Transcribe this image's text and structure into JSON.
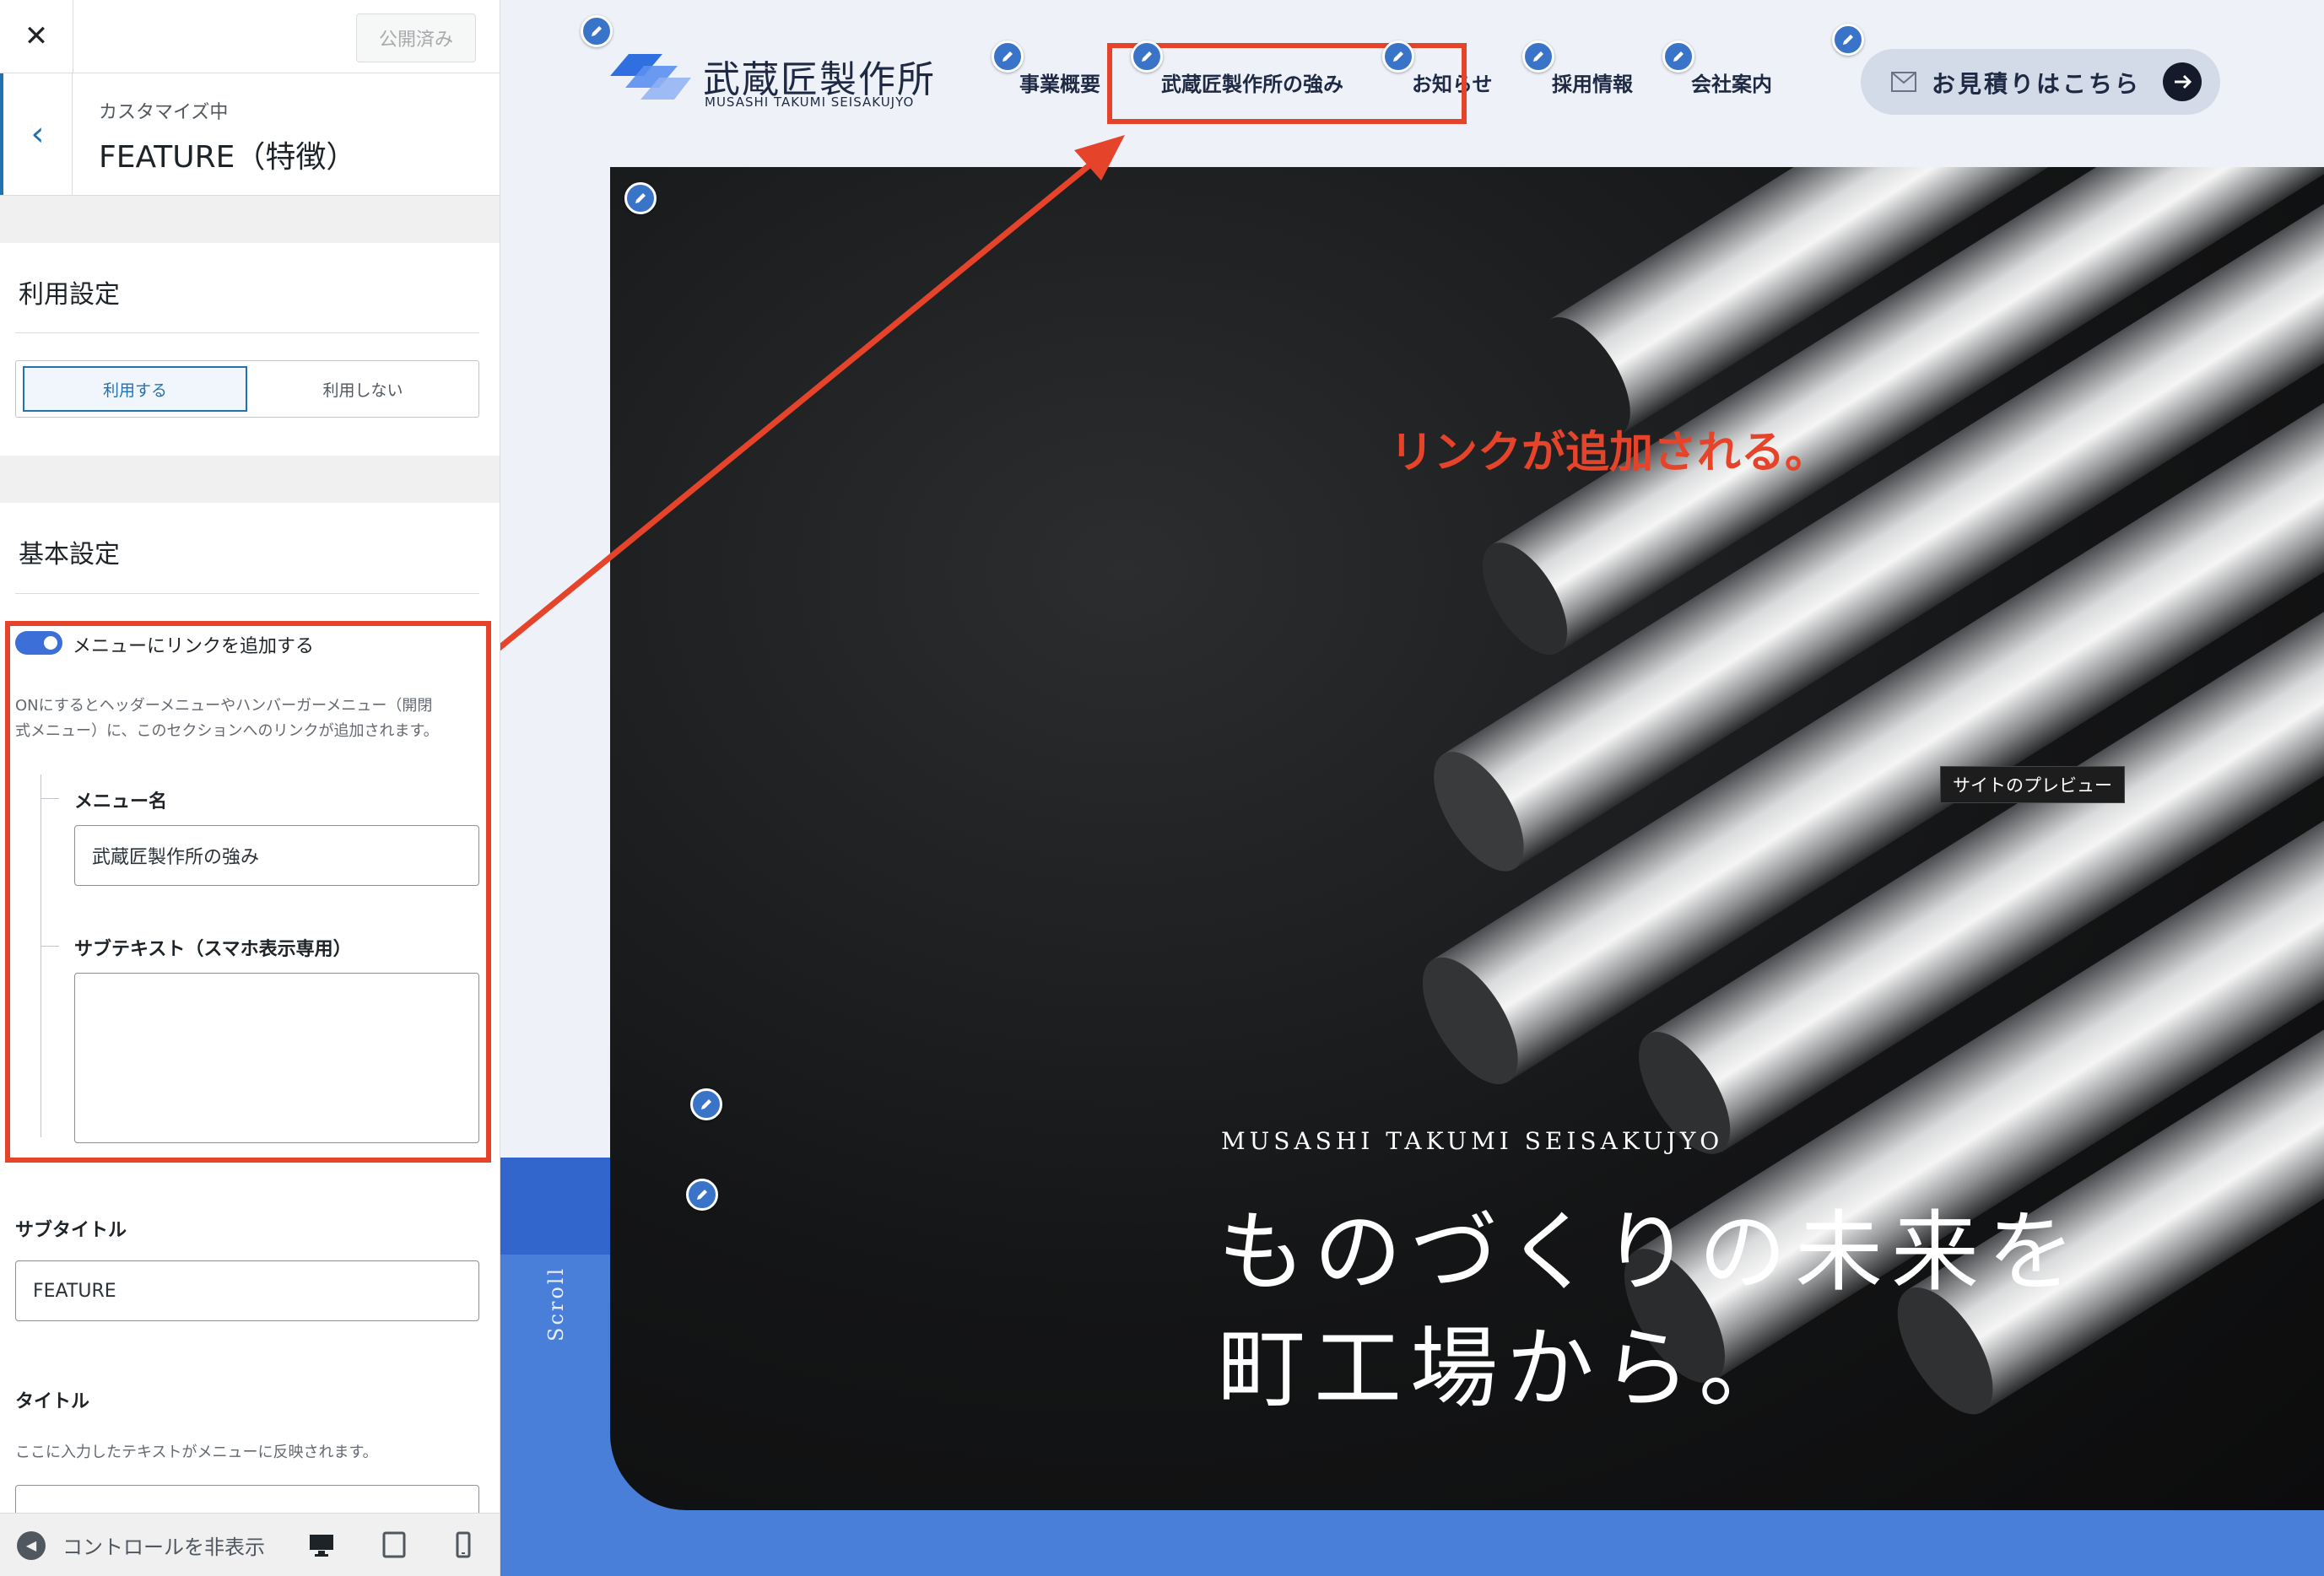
{
  "sidebar": {
    "publish_label": "公開済み",
    "crumb": "カスタマイズ中",
    "title": "FEATURE（特徴）",
    "usage": {
      "heading": "利用設定",
      "on_label": "利用する",
      "off_label": "利用しない",
      "selected": "利用する"
    },
    "basic": {
      "heading": "基本設定",
      "toggle_label": "メニューにリンクを追加する",
      "toggle_on": true,
      "desc_line1": "ONにするとヘッダーメニューやハンバーガーメニュー（開閉",
      "desc_line2": "式メニュー）に、このセクションへのリンクが追加されます。",
      "menu_name_label": "メニュー名",
      "menu_name_value": "武蔵匠製作所の強み",
      "subtext_label": "サブテキスト（スマホ表示専用）",
      "subtext_value": ""
    },
    "subtitle": {
      "label": "サブタイトル",
      "value": "FEATURE"
    },
    "title_field": {
      "label": "タイトル",
      "desc": "ここに入力したテキストがメニューに反映されます。"
    },
    "footer": {
      "hide_controls": "コントロールを非表示"
    }
  },
  "preview": {
    "logo": {
      "ja": "武蔵匠製作所",
      "en": "MUSASHI TAKUMI SEISAKUJYO"
    },
    "nav": [
      "事業概要",
      "武蔵匠製作所の強み",
      "お知らせ",
      "採用情報",
      "会社案内"
    ],
    "cta_label": "お見積りはこちら",
    "annotation": "リンクが追加される。",
    "tooltip": "サイトのプレビュー",
    "hero_sub": "MUSASHI TAKUMI SEISAKUJYO",
    "hero_title_line1": "ものづくりの未来を",
    "hero_title_line2": "町工場から。",
    "scroll": "Scroll"
  },
  "colors": {
    "accent": "#2271b1",
    "annotation_red": "#e5432a",
    "band_blue": "#4a7fd9",
    "edit_blue": "#3a74c9"
  }
}
